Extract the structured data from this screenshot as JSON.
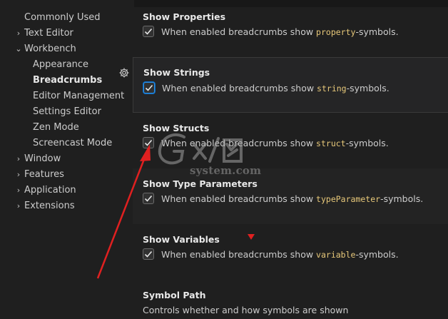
{
  "sidebar": {
    "items": [
      {
        "label": "Commonly Used",
        "chevron": ""
      },
      {
        "label": "Text Editor",
        "chevron": "›"
      },
      {
        "label": "Workbench",
        "chevron": "⌄"
      },
      {
        "label": "Appearance",
        "chevron": ""
      },
      {
        "label": "Breadcrumbs",
        "chevron": "",
        "active": true
      },
      {
        "label": "Editor Management",
        "chevron": ""
      },
      {
        "label": "Settings Editor",
        "chevron": ""
      },
      {
        "label": "Zen Mode",
        "chevron": ""
      },
      {
        "label": "Screencast Mode",
        "chevron": ""
      },
      {
        "label": "Window",
        "chevron": "›"
      },
      {
        "label": "Features",
        "chevron": "›"
      },
      {
        "label": "Application",
        "chevron": "›"
      },
      {
        "label": "Extensions",
        "chevron": "›"
      }
    ]
  },
  "settings": [
    {
      "title": "Show Properties",
      "prefix": "When enabled breadcrumbs show ",
      "code": "property",
      "suffix": "-symbols.",
      "checked": true
    },
    {
      "title": "Show Strings",
      "prefix": "When enabled breadcrumbs show ",
      "code": "string",
      "suffix": "-symbols.",
      "checked": true
    },
    {
      "title": "Show Structs",
      "prefix": "When enabled breadcrumbs show ",
      "code": "struct",
      "suffix": "-symbols.",
      "checked": true
    },
    {
      "title": "Show Type Parameters",
      "prefix": "When enabled breadcrumbs show ",
      "code": "typeParameter",
      "suffix": "-symbols.",
      "checked": true
    },
    {
      "title": "Show Variables",
      "prefix": "When enabled breadcrumbs show ",
      "code": "variable",
      "suffix": "-symbols.",
      "checked": true
    },
    {
      "title": "Symbol Path",
      "description": "Controls whether and how symbols are shown"
    }
  ],
  "watermark": {
    "logo_text": "GX/网",
    "domain": "system.com"
  },
  "colors": {
    "background": "#1f1f1f",
    "accent": "#0b6cc7",
    "code": "#e8c97a",
    "annotation": "#e02020"
  },
  "icons": {
    "gear": "gear-icon",
    "check": "check-icon",
    "chevron_right": "chevron-right-icon",
    "chevron_down": "chevron-down-icon"
  }
}
